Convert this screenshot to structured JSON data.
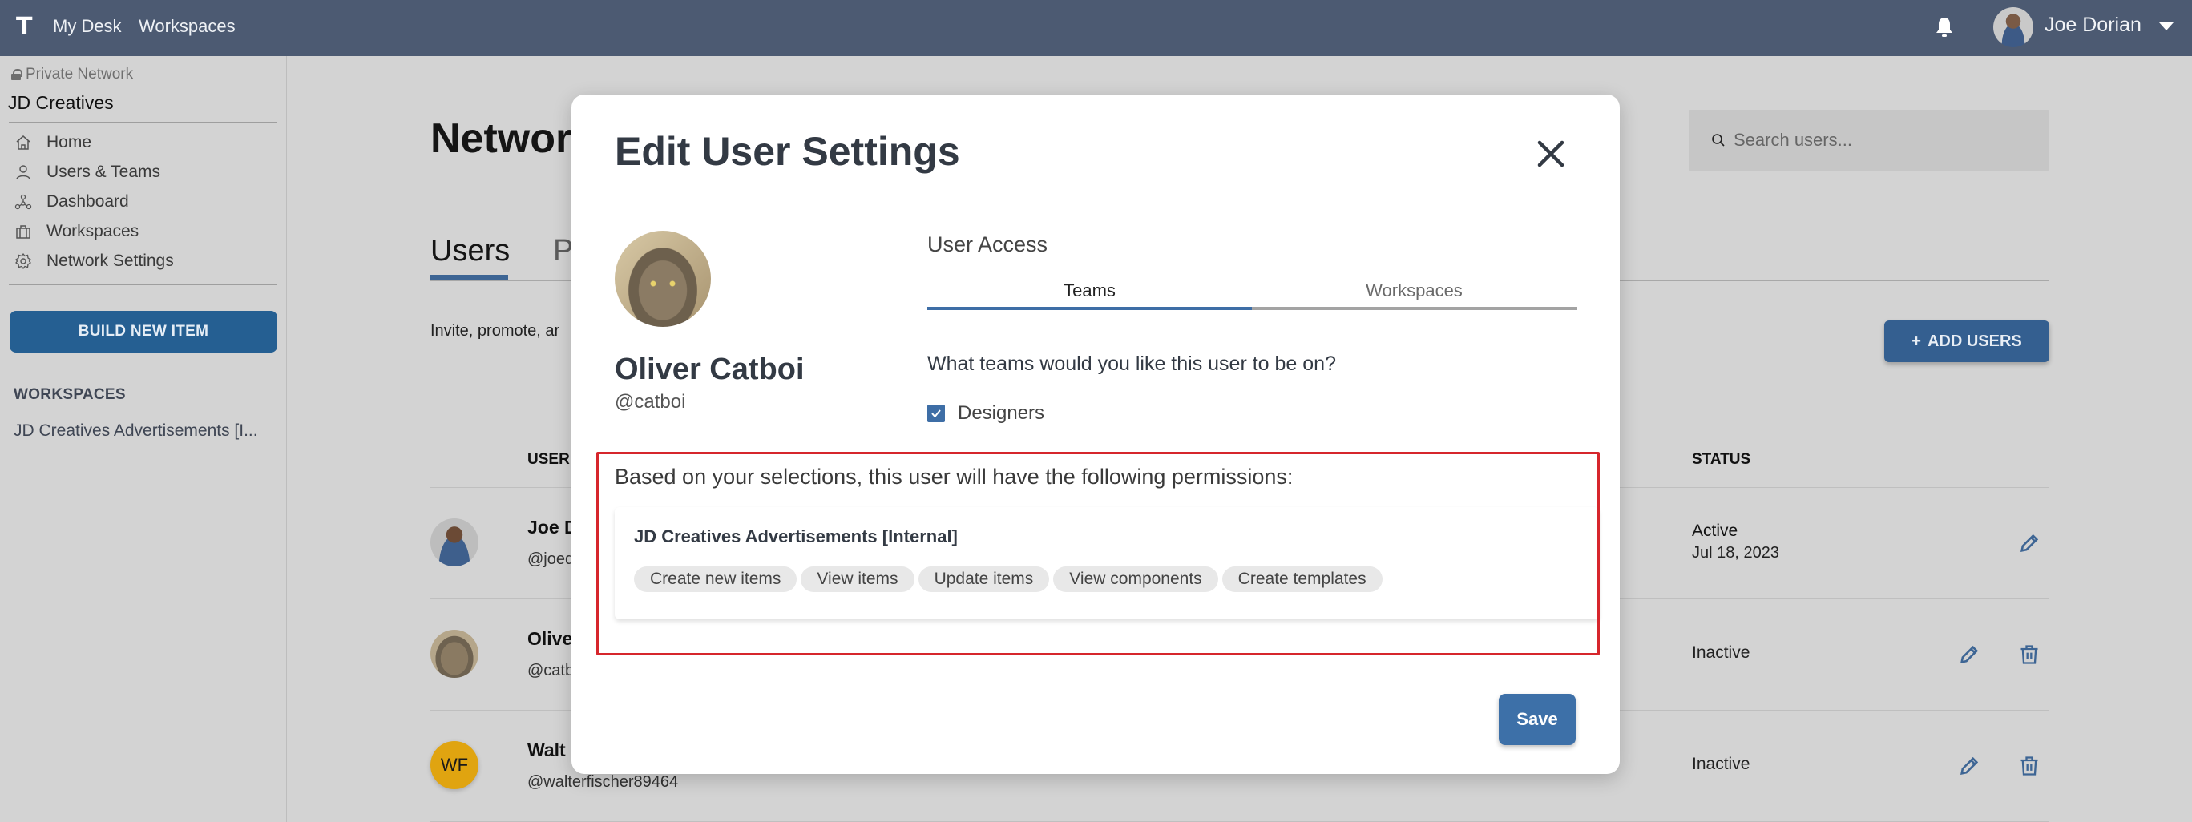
{
  "topbar": {
    "logo": "T",
    "nav": [
      "My Desk",
      "Workspaces"
    ],
    "notifications_icon": "bell-icon",
    "user_name": "Joe Dorian",
    "user_menu_icon": "caret-down-icon"
  },
  "sidebar": {
    "network_label": "Private Network",
    "org_name": "JD Creatives",
    "items": [
      {
        "label": "Home",
        "icon": "home-icon"
      },
      {
        "label": "Users & Teams",
        "icon": "user-icon"
      },
      {
        "label": "Dashboard",
        "icon": "network-icon"
      },
      {
        "label": "Workspaces",
        "icon": "briefcase-icon"
      },
      {
        "label": "Network Settings",
        "icon": "gear-icon"
      }
    ],
    "build_button": "BUILD NEW ITEM",
    "workspaces_heading": "WORKSPACES",
    "workspaces": [
      "JD Creatives Advertisements [I..."
    ]
  },
  "main": {
    "title_visible": "Networ",
    "tabs": [
      {
        "label": "Users",
        "active": true
      },
      {
        "label": "P",
        "active": false
      }
    ],
    "description_visible": "Invite, promote, ar",
    "search_placeholder": "Search users...",
    "add_users_button": "ADD USERS",
    "columns": {
      "user": "USER",
      "status": "STATUS"
    },
    "rows": [
      {
        "name_visible": "Joe D",
        "handle_visible": "@joed",
        "status": "Active",
        "date": "Jul 18, 2023",
        "actions": [
          "edit"
        ]
      },
      {
        "name_visible": "Olive",
        "handle_visible": "@catb",
        "status": "Inactive",
        "date": "",
        "actions": [
          "edit",
          "delete"
        ]
      },
      {
        "name_visible": "Walt",
        "handle_visible": "@walterfischer89464",
        "initials": "WF",
        "status": "Inactive",
        "date": "",
        "actions": [
          "edit",
          "delete"
        ]
      }
    ]
  },
  "modal": {
    "title": "Edit User Settings",
    "user": {
      "name": "Oliver Catboi",
      "handle": "@catboi"
    },
    "access_label": "User Access",
    "tabs": [
      {
        "label": "Teams",
        "active": true
      },
      {
        "label": "Workspaces",
        "active": false
      }
    ],
    "question": "What teams would you like this user to be on?",
    "teams": [
      {
        "label": "Designers",
        "checked": true
      }
    ],
    "permissions_intro": "Based on your selections, this user will have the following permissions:",
    "permissions": [
      {
        "workspace": "JD Creatives Advertisements [Internal]",
        "chips": [
          "Create new items",
          "View items",
          "Update items",
          "View components",
          "Create templates"
        ]
      }
    ],
    "save_button": "Save"
  },
  "colors": {
    "topbar": "#4c5a72",
    "primary": "#3d70a8",
    "sidebar_button": "#255f92",
    "annotation": "#d6262c",
    "background": "#d3d3d3",
    "wf_avatar": "#e0a410"
  }
}
